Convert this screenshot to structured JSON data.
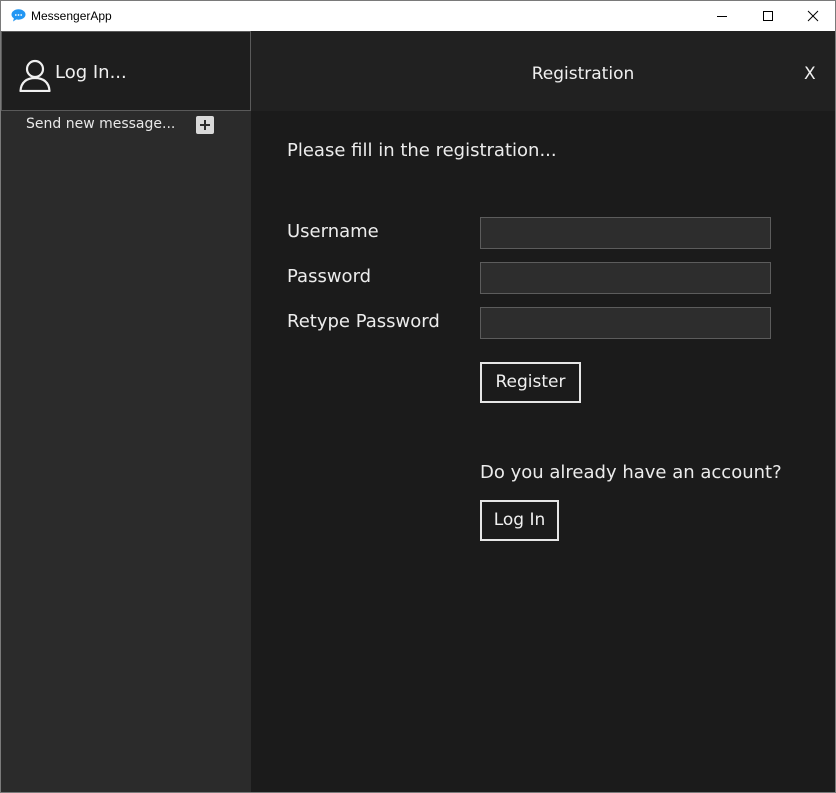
{
  "window": {
    "title": "MessengerApp",
    "controls": [
      "minimize-icon",
      "maximize-icon",
      "close-icon"
    ],
    "accent_color": "#2196f3"
  },
  "sidebar": {
    "login_label": "Log In...",
    "user_icon": "user-icon",
    "send_new_message_label": "Send new message...",
    "add_icon": "plus-icon"
  },
  "main": {
    "title": "Registration",
    "close_label": "X",
    "instructions": "Please fill in the registration...",
    "form": {
      "username_label": "Username",
      "username_value": "",
      "password_label": "Password",
      "password_value": "",
      "retype_password_label": "Retype Password",
      "retype_password_value": "",
      "register_button": "Register"
    },
    "have_account_text": "Do you already have an account?",
    "login_button": "Log In"
  }
}
